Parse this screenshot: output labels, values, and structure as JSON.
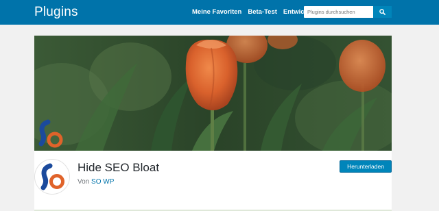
{
  "header": {
    "brand": "Plugins",
    "nav": [
      {
        "label": "Meine Favoriten"
      },
      {
        "label": "Beta-Test"
      },
      {
        "label": "Entwickler"
      }
    ],
    "search": {
      "placeholder": "Plugins durchsuchen",
      "icon": "search-icon"
    }
  },
  "plugin": {
    "name": "Hide SEO Bloat",
    "by_prefix": "Von",
    "author": "SO WP",
    "download_label": "Herunterladen"
  },
  "colors": {
    "header_bg": "#0073aa",
    "button_bg": "#0085ba",
    "logo_blue": "#1b4a9c",
    "logo_orange": "#e0632a"
  }
}
